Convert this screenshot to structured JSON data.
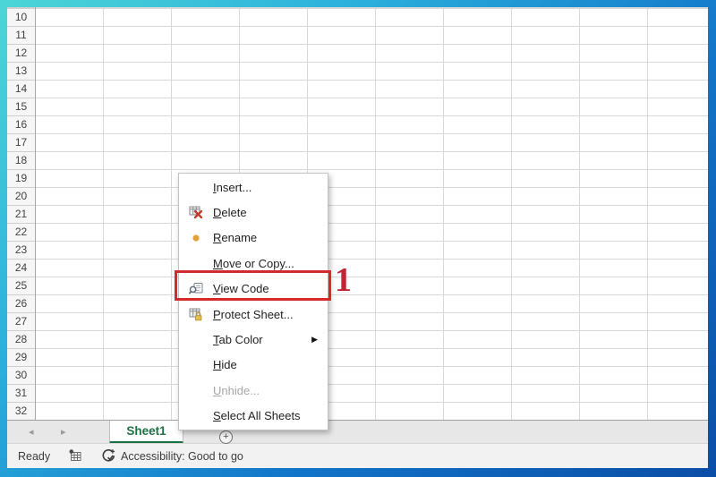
{
  "grid": {
    "rows": [
      "10",
      "11",
      "12",
      "13",
      "14",
      "15",
      "16",
      "17",
      "18",
      "19",
      "20",
      "21",
      "22",
      "23",
      "24",
      "25",
      "26",
      "27",
      "28",
      "29",
      "30",
      "31",
      "32"
    ]
  },
  "sheet_tabs": {
    "active_tab": "Sheet1",
    "prev_icon": "◂",
    "next_icon": "▸",
    "new_sheet_icon": "+"
  },
  "status_bar": {
    "mode": "Ready",
    "macro_icon": "macro-record-icon",
    "accessibility_icon": "accessibility-checker-icon",
    "accessibility_text": "Accessibility: Good to go"
  },
  "context_menu": {
    "submenu_arrow": "▶",
    "items": [
      {
        "key": "I",
        "rest": "nsert...",
        "icon": "none"
      },
      {
        "key": "D",
        "rest": "elete",
        "icon": "delete-sheet-icon"
      },
      {
        "key": "R",
        "rest": "ename",
        "icon": "rename-bullet-icon"
      },
      {
        "key": "M",
        "rest": "ove or Copy...",
        "icon": "none"
      },
      {
        "key": "V",
        "rest": "iew Code",
        "icon": "view-code-icon",
        "highlighted": true
      },
      {
        "key": "P",
        "rest": "rotect Sheet...",
        "icon": "protect-sheet-icon"
      },
      {
        "key": "T",
        "rest": "ab Color",
        "icon": "none",
        "submenu": true
      },
      {
        "key": "H",
        "rest": "ide",
        "icon": "none"
      },
      {
        "key": "U",
        "rest": "nhide...",
        "icon": "none",
        "disabled": true
      },
      {
        "key": "S",
        "rest": "elect All Sheets",
        "icon": "none"
      }
    ]
  },
  "annotation": {
    "step_number": "1"
  },
  "colors": {
    "excel_green": "#1E7145",
    "highlight_red": "#D42A2A",
    "callout_red": "#C22434",
    "frame_gradient_start": "#4DD6D6",
    "frame_gradient_end": "#0B4DA6"
  }
}
